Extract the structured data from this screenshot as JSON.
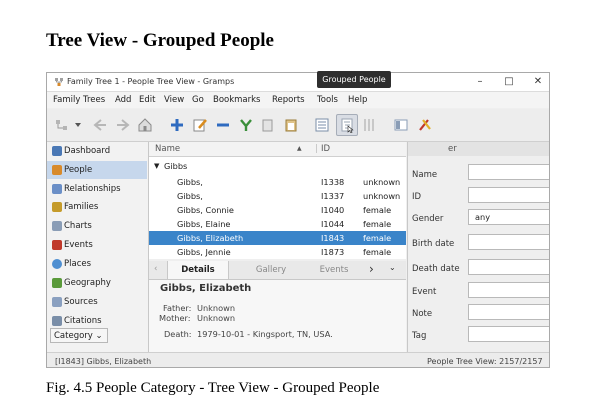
{
  "page_heading": "Tree View - Grouped People",
  "caption": "Fig. 4.5 People Category - Tree View - Grouped People",
  "window": {
    "title": "Family Tree 1 - People Tree View - Gramps",
    "controls": [
      "–",
      "□",
      "✕"
    ]
  },
  "menu": [
    "Family Trees",
    "Add",
    "Edit",
    "View",
    "Go",
    "Bookmarks",
    "Reports",
    "Tools",
    "Help"
  ],
  "tooltip": "Grouped People",
  "sidebar": {
    "items": [
      {
        "label": "Dashboard",
        "icon": "dashboard-icon",
        "color": "#4a78b5"
      },
      {
        "label": "People",
        "icon": "people-icon",
        "color": "#d88a2b"
      },
      {
        "label": "Relationships",
        "icon": "relationships-icon",
        "color": "#6b8fc7"
      },
      {
        "label": "Families",
        "icon": "families-icon",
        "color": "#c59b2a"
      },
      {
        "label": "Charts",
        "icon": "charts-icon",
        "color": "#8a9db6"
      },
      {
        "label": "Events",
        "icon": "events-icon",
        "color": "#c0392b"
      },
      {
        "label": "Places",
        "icon": "places-icon",
        "color": "#4f8fd1"
      },
      {
        "label": "Geography",
        "icon": "geography-icon",
        "color": "#5a9a3a"
      },
      {
        "label": "Sources",
        "icon": "sources-icon",
        "color": "#8aa0c0"
      },
      {
        "label": "Citations",
        "icon": "citations-icon",
        "color": "#7a8ea8"
      }
    ],
    "category_button": "Category"
  },
  "tree": {
    "headers": {
      "name": "Name",
      "id": "ID"
    },
    "group": "Gibbs",
    "rows": [
      {
        "name": "Gibbs,",
        "id": "I1338",
        "gender": "unknown"
      },
      {
        "name": "Gibbs,",
        "id": "I1337",
        "gender": "unknown"
      },
      {
        "name": "Gibbs, Connie",
        "id": "I1040",
        "gender": "female"
      },
      {
        "name": "Gibbs, Elaine",
        "id": "I1044",
        "gender": "female"
      },
      {
        "name": "Gibbs, Elizabeth",
        "id": "I1843",
        "gender": "female"
      },
      {
        "name": "Gibbs, Jennie",
        "id": "I1873",
        "gender": "female"
      }
    ]
  },
  "tabs": [
    "Details",
    "Gallery",
    "Events"
  ],
  "details": {
    "name": "Gibbs, Elizabeth",
    "father_label": "Father:",
    "father_value": "Unknown",
    "mother_label": "Mother:",
    "mother_value": "Unknown",
    "death_label": "Death:",
    "death_value": "1979-10-01 - Kingsport, TN, USA."
  },
  "filter": {
    "header_tail": "er",
    "fields": [
      {
        "label": "Name",
        "value": ""
      },
      {
        "label": "ID",
        "value": ""
      },
      {
        "label": "Gender",
        "value": "any"
      },
      {
        "label": "Birth date",
        "value": ""
      },
      {
        "label": "Death date",
        "value": ""
      },
      {
        "label": "Event",
        "value": ""
      },
      {
        "label": "Note",
        "value": ""
      },
      {
        "label": "Tag",
        "value": ""
      }
    ]
  },
  "status": {
    "left": "[I1843] Gibbs, Elizabeth",
    "right": "People Tree View: 2157/2157"
  }
}
